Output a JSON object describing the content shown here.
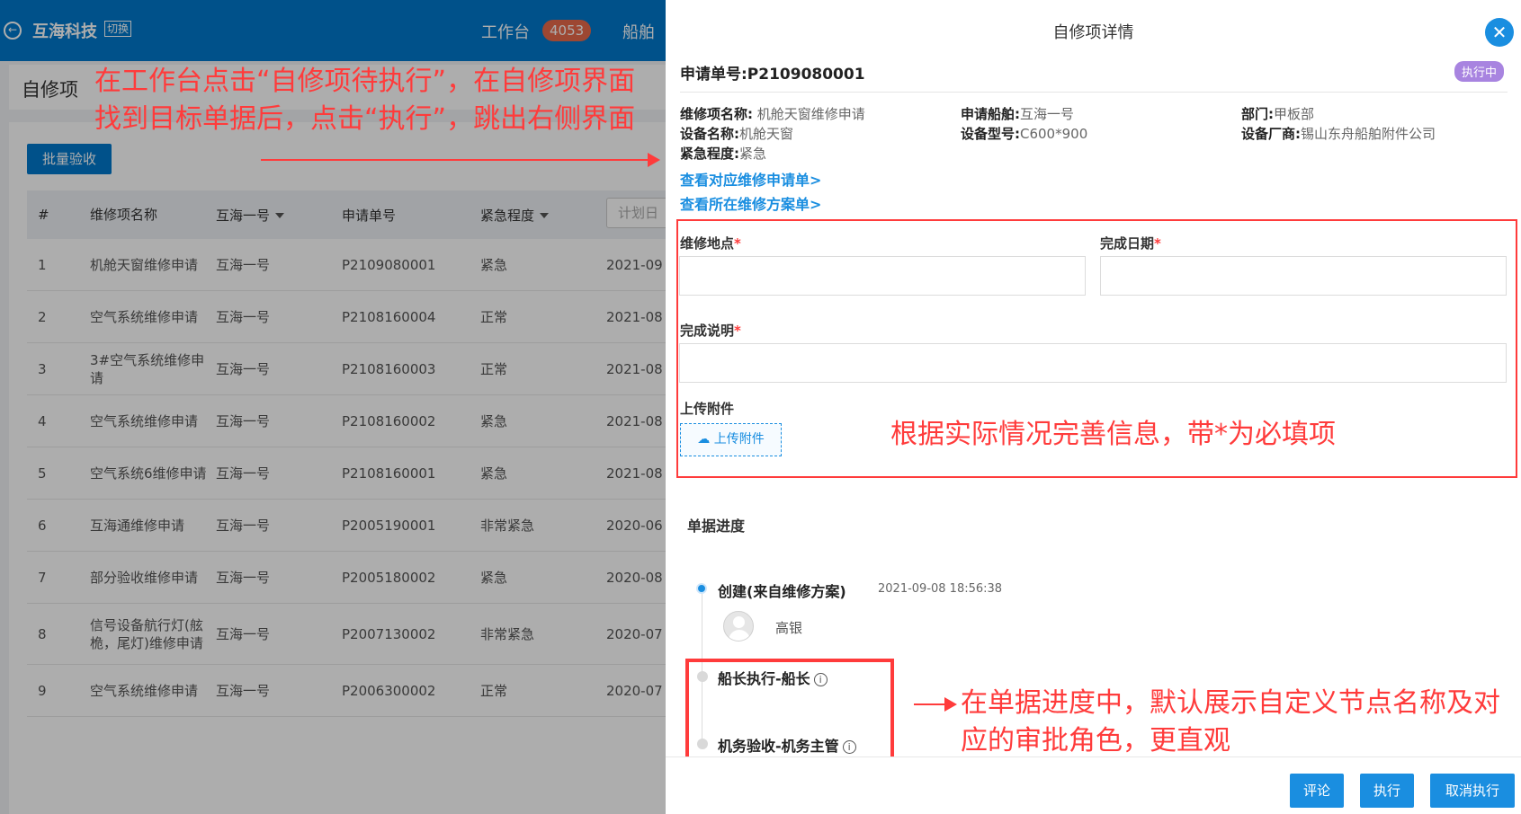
{
  "topbar": {
    "company": "互海科技",
    "switch_label": "切换",
    "nav_workbench": "工作台",
    "workbench_badge": "4053",
    "nav_ship": "船舶"
  },
  "left_page": {
    "title": "自修项",
    "batch_accept": "批量验收",
    "columns": [
      "#",
      "维修项名称",
      "互海一号",
      "申请单号",
      "紧急程度",
      "计划日"
    ],
    "rows": [
      {
        "no": "1",
        "name": "机舱天窗维修申请",
        "ship": "互海一号",
        "req": "P2109080001",
        "urgency": "紧急",
        "date": "2021-09"
      },
      {
        "no": "2",
        "name": "空气系统维修申请",
        "ship": "互海一号",
        "req": "P2108160004",
        "urgency": "正常",
        "date": "2021-08"
      },
      {
        "no": "3",
        "name": "3#空气系统维修申请",
        "ship": "互海一号",
        "req": "P2108160003",
        "urgency": "正常",
        "date": "2021-08"
      },
      {
        "no": "4",
        "name": "空气系统维修申请",
        "ship": "互海一号",
        "req": "P2108160002",
        "urgency": "紧急",
        "date": "2021-08"
      },
      {
        "no": "5",
        "name": "空气系统6维修申请",
        "ship": "互海一号",
        "req": "P2108160001",
        "urgency": "紧急",
        "date": "2021-08"
      },
      {
        "no": "6",
        "name": "互海通维修申请",
        "ship": "互海一号",
        "req": "P2005190001",
        "urgency": "非常紧急",
        "date": "2020-06"
      },
      {
        "no": "7",
        "name": "部分验收维修申请",
        "ship": "互海一号",
        "req": "P2005180002",
        "urgency": "紧急",
        "date": "2020-08"
      },
      {
        "no": "8",
        "name": "信号设备航行灯(舷桅，尾灯)维修申请",
        "ship": "互海一号",
        "req": "P2007130002",
        "urgency": "非常紧急",
        "date": "2020-07"
      },
      {
        "no": "9",
        "name": "空气系统维修申请",
        "ship": "互海一号",
        "req": "P2006300002",
        "urgency": "正常",
        "date": "2020-07"
      }
    ]
  },
  "annotations": {
    "left": "在工作台点击“自修项待执行”，在自修项界面找到目标单据后，点击“执行”，跳出右侧界面",
    "form": "根据实际情况完善信息，带*为必填项",
    "timeline": "在单据进度中，默认展示自定义节点名称及对应的审批角色，更直观"
  },
  "drawer": {
    "title": "自修项详情",
    "request_no": "申请单号:P2109080001",
    "status": "执行中",
    "info": {
      "item_name_label": "维修项名称:",
      "item_name": "机舱天窗维修申请",
      "ship_label": "申请船舶:",
      "ship": "互海一号",
      "dept_label": "部门:",
      "dept": "甲板部",
      "equip_name_label": "设备名称:",
      "equip_name": "机舱天窗",
      "equip_model_label": "设备型号:",
      "equip_model": "C600*900",
      "maker_label": "设备厂商:",
      "maker": "锡山东舟船舶附件公司",
      "urgency_label": "紧急程度:",
      "urgency": "紧急"
    },
    "link_request": "查看对应维修申请单>",
    "link_plan": "查看所在维修方案单>",
    "form": {
      "location_label": "维修地点",
      "date_label": "完成日期",
      "desc_label": "完成说明",
      "attach_label": "上传附件",
      "upload_button": "上传附件",
      "required_mark": "*"
    },
    "progress": {
      "title": "单据进度",
      "node1": "创建(来自维修方案)",
      "node1_time": "2021-09-08 18:56:38",
      "node1_person": "高银",
      "node2": "船长执行-船长",
      "node3": "机务验收-机务主管"
    },
    "footer": {
      "comment": "评论",
      "execute": "执行",
      "cancel": "取消执行"
    }
  }
}
